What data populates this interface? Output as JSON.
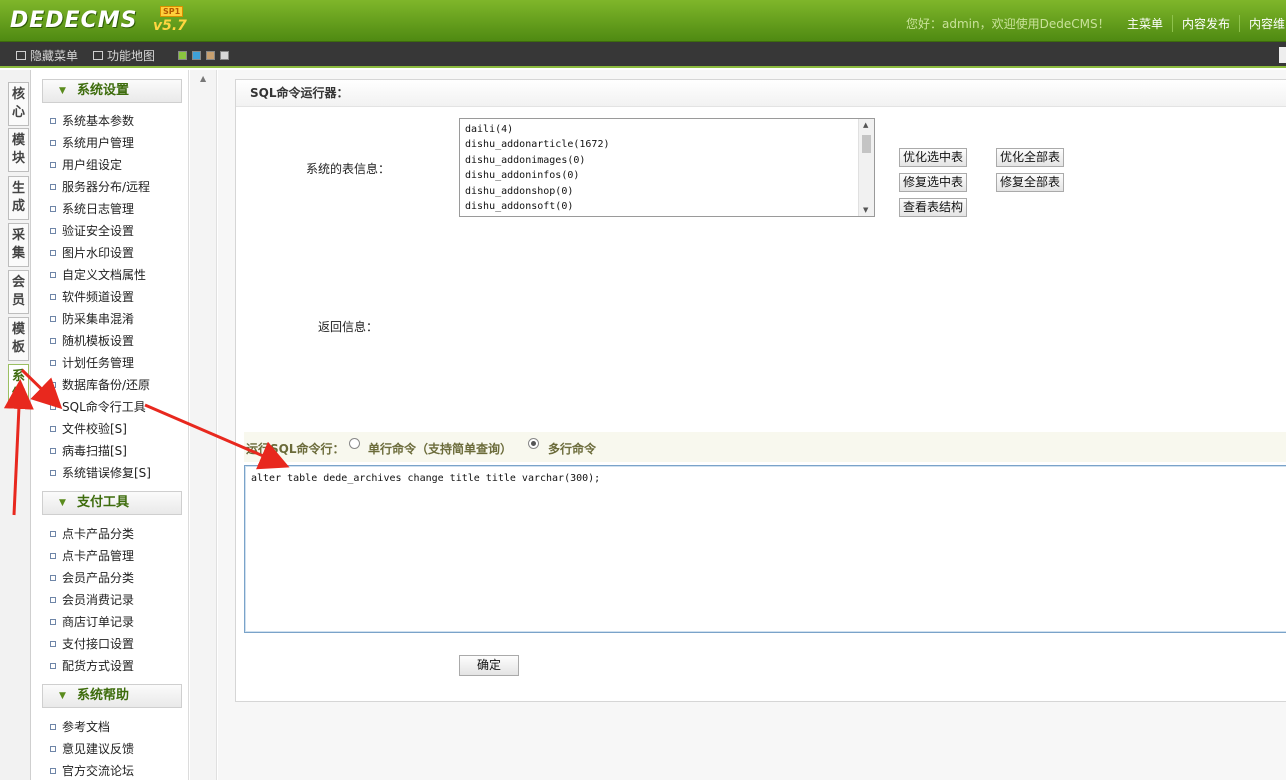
{
  "header": {
    "logo": "DEDECMS",
    "version": "v5.7",
    "sp_badge": "SP1",
    "welcome": "您好：admin，欢迎使用DedeCMS！",
    "nav": [
      "主菜单",
      "内容发布",
      "内容维"
    ]
  },
  "toolbar": {
    "hide_menu": "隐藏菜单",
    "func_map": "功能地图",
    "swatches": [
      "#8ac43f",
      "#3ea0d8",
      "#c8a070",
      "#d8d8d8"
    ]
  },
  "vtabs": [
    {
      "label": "核心",
      "active": false
    },
    {
      "label": "模块",
      "active": false
    },
    {
      "label": "生成",
      "active": false
    },
    {
      "label": "采集",
      "active": false
    },
    {
      "label": "会员",
      "active": false
    },
    {
      "label": "模板",
      "active": false
    },
    {
      "label": "系统",
      "active": true
    }
  ],
  "menu": {
    "sections": [
      {
        "title": "系统设置",
        "items": [
          "系统基本参数",
          "系统用户管理",
          "用户组设定",
          "服务器分布/远程",
          "系统日志管理",
          "验证安全设置",
          "图片水印设置",
          "自定义文档属性",
          "软件频道设置",
          "防采集串混淆",
          "随机模板设置",
          "计划任务管理",
          "数据库备份/还原",
          "SQL命令行工具",
          "文件校验[S]",
          "病毒扫描[S]",
          "系统错误修复[S]"
        ]
      },
      {
        "title": "支付工具",
        "items": [
          "点卡产品分类",
          "点卡产品管理",
          "会员产品分类",
          "会员消费记录",
          "商店订单记录",
          "支付接口设置",
          "配货方式设置"
        ]
      },
      {
        "title": "系统帮助",
        "items": [
          "参考文档",
          "意见建议反馈",
          "官方交流论坛"
        ]
      }
    ]
  },
  "main": {
    "panel_title": "SQL命令运行器：",
    "table_info_label": "系统的表信息：",
    "tables": [
      "daili(4)",
      "dishu_addonarticle(1672)",
      "dishu_addonimages(0)",
      "dishu_addoninfos(0)",
      "dishu_addonshop(0)",
      "dishu_addonsoft(0)"
    ],
    "buttons": {
      "optimize_selected": "优化选中表",
      "optimize_all": "优化全部表",
      "repair_selected": "修复选中表",
      "repair_all": "修复全部表",
      "view_structure": "查看表结构"
    },
    "return_info_label": "返回信息：",
    "run_label": "运行SQL命令行：",
    "mode_single": "单行命令（支持简单查询）",
    "mode_multi": "多行命令",
    "selected_mode": "multi",
    "sql_text": "alter table dede_archives change title title varchar(300);",
    "submit": "确定"
  },
  "colors": {
    "header_green": "#5e9a18",
    "annotation_red": "#e8281e"
  }
}
